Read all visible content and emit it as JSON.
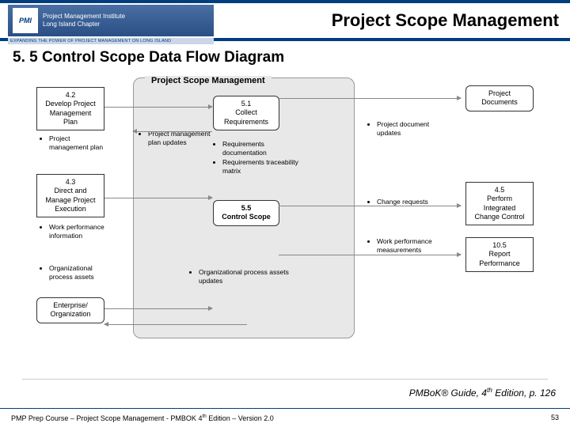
{
  "header": {
    "logo_badge": "PMI",
    "logo_line1": "Project Management Institute",
    "logo_line2": "Long Island Chapter",
    "logo_tag": "EXPANDING THE POWER OF PROJECT MANAGEMENT ON LONG ISLAND",
    "title": "Project Scope Management"
  },
  "section_title": "5. 5 Control Scope Data Flow Diagram",
  "diagram": {
    "panel_title": "Project Scope Management",
    "left": {
      "box42": "4.2\nDevelop Project\nManagement\nPlan",
      "bul42": "Project management plan",
      "box43": "4.3\nDirect and\nManage Project\nExecution",
      "bul43": "Work performance information",
      "bulOrg": "Organizational process assets",
      "boxEnt": "Enterprise/\nOrganization"
    },
    "center": {
      "box51": "5.1\nCollect\nRequirements",
      "bul51a": "Requirements documentation",
      "bul51b": "Requirements traceability matrix",
      "box55": "5.5\nControl Scope",
      "bul_pmpu": "Project management plan updates",
      "bulOpau": "Organizational process assets updates"
    },
    "right": {
      "boxPD": "Project\nDocuments",
      "bulPDU": "Project document updates",
      "bulCR": "Change requests",
      "box45": "4.5\nPerform\nIntegrated\nChange Control",
      "bulWPM": "Work performance measurements",
      "box105": "10.5\nReport\nPerformance"
    }
  },
  "citation_prefix": "PMBoK® Guide, 4",
  "citation_sup": "th",
  "citation_suffix": " Edition, p. 126",
  "footer_left_a": "PMP Prep Course – Project Scope Management - PMBOK 4",
  "footer_left_sup": "th",
  "footer_left_b": " Edition – Version 2.0",
  "footer_right": "53"
}
